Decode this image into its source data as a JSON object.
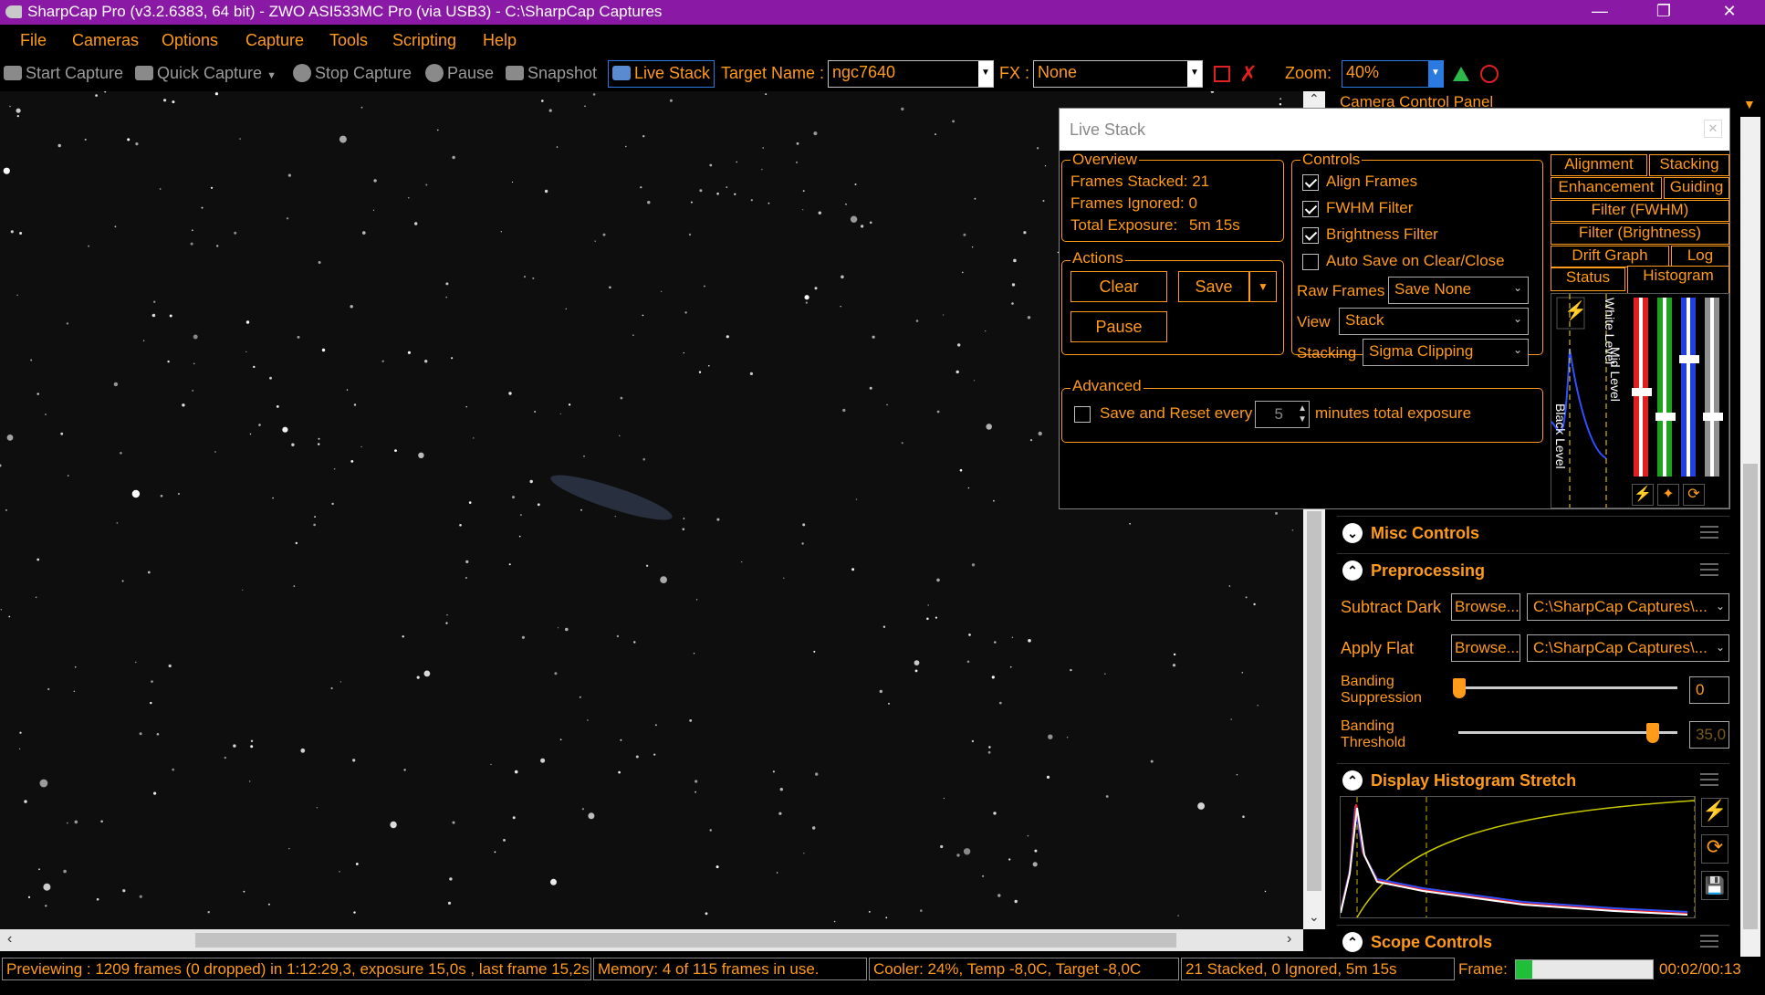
{
  "window": {
    "title": "SharpCap Pro (v3.2.6383, 64 bit) - ZWO ASI533MC Pro (via USB3) - C:\\SharpCap Captures"
  },
  "menu": [
    "File",
    "Cameras",
    "Options",
    "Capture",
    "Tools",
    "Scripting",
    "Help"
  ],
  "toolbar": {
    "start_capture": "Start Capture",
    "quick_capture": "Quick Capture",
    "stop_capture": "Stop Capture",
    "pause": "Pause",
    "snapshot": "Snapshot",
    "live_stack": "Live Stack",
    "target_name_label": "Target Name :",
    "target_name_value": "ngc7640",
    "fx_label": "FX :",
    "fx_value": "None",
    "zoom_label": "Zoom:",
    "zoom_value": "40%"
  },
  "live_stack": {
    "title": "Live Stack",
    "overview": {
      "label": "Overview",
      "frames_stacked": "Frames Stacked: 21",
      "frames_ignored": "Frames Ignored:  0",
      "total_exposure_label": "Total Exposure:",
      "total_exposure_value": "5m 15s"
    },
    "actions": {
      "label": "Actions",
      "clear": "Clear",
      "save": "Save",
      "pause": "Pause"
    },
    "controls": {
      "label": "Controls",
      "align_frames": "Align Frames",
      "fwhm_filter": "FWHM Filter",
      "brightness_filter": "Brightness Filter",
      "auto_save": "Auto Save on Clear/Close",
      "raw_frames_label": "Raw Frames",
      "raw_frames_value": "Save None",
      "view_label": "View",
      "view_value": "Stack",
      "stacking_label": "Stacking",
      "stacking_value": "Sigma Clipping"
    },
    "advanced": {
      "label": "Advanced",
      "save_reset": "Save and Reset every",
      "minutes_value": "5",
      "minutes_suffix": "minutes total exposure"
    },
    "tabs": [
      "Alignment",
      "Stacking",
      "Enhancement",
      "Guiding",
      "Filter (FWHM)",
      "Filter (Brightness)",
      "Drift Graph",
      "Log",
      "Status",
      "Histogram"
    ],
    "histogram_labels": {
      "white_level": "White Level",
      "mid_level": "Mid Level",
      "black_level": "Black Level"
    }
  },
  "panel": {
    "title": "Camera Control Panel",
    "misc_controls": "Misc Controls",
    "preprocessing": "Preprocessing",
    "subtract_dark_label": "Subtract Dark",
    "browse": "Browse...",
    "dark_path": "C:\\SharpCap Captures\\...",
    "apply_flat_label": "Apply Flat",
    "flat_path": "C:\\SharpCap Captures\\...",
    "banding_suppression_label_1": "Banding",
    "banding_suppression_label_2": "Suppression",
    "banding_suppression_value": "0",
    "banding_threshold_label_1": "Banding",
    "banding_threshold_label_2": "Threshold",
    "banding_threshold_value": "35,0",
    "display_histogram_stretch": "Display Histogram Stretch",
    "scope_controls": "Scope Controls"
  },
  "status": {
    "previewing": "Previewing : 1209 frames (0 dropped) in 1:12:29,3, exposure 15,0s , last frame 15,2s",
    "memory": "Memory: 4 of 115 frames in use.",
    "cooler": "Cooler: 24%, Temp -8,0C, Target -8,0C",
    "stacked": "21 Stacked, 0 Ignored, 5m 15s",
    "frame_label": "Frame:",
    "frame_progress": 0.12,
    "time": "00:02/00:13"
  },
  "colors": {
    "title_bar": "#8a1aa6",
    "accent": "#ff9a1a",
    "background": "#000000"
  }
}
